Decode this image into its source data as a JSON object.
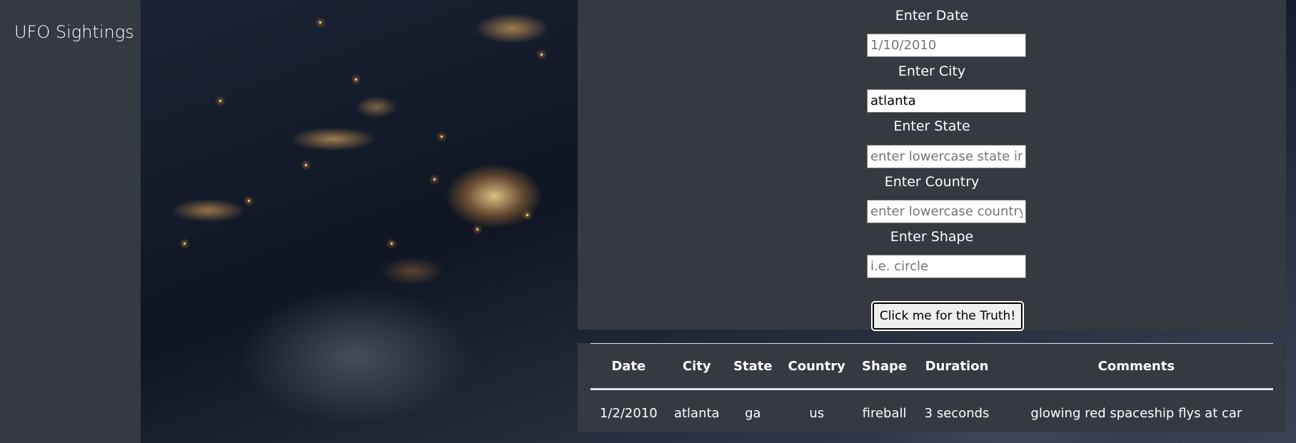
{
  "navbar": {
    "brand": "UFO Sightings"
  },
  "form": {
    "fields": [
      {
        "label": "Enter Date",
        "placeholder": "1/10/2010",
        "value": ""
      },
      {
        "label": "Enter City",
        "placeholder": "",
        "value": "atlanta"
      },
      {
        "label": "Enter State",
        "placeholder": "enter lowercase state initi",
        "value": ""
      },
      {
        "label": "Enter Country",
        "placeholder": "enter lowercase country i",
        "value": ""
      },
      {
        "label": "Enter Shape",
        "placeholder": "i.e. circle",
        "value": ""
      }
    ],
    "submit_label": "Click me for the Truth!"
  },
  "table": {
    "headers": [
      "Date",
      "City",
      "State",
      "Country",
      "Shape",
      "Duration",
      "Comments"
    ],
    "rows": [
      [
        "1/2/2010",
        "atlanta",
        "ga",
        "us",
        "fireball",
        "3 seconds",
        "glowing red spaceship flys at car"
      ]
    ]
  },
  "colors": {
    "panel": "#343a40",
    "text": "#ffffff",
    "rule": "#dee2e6"
  }
}
